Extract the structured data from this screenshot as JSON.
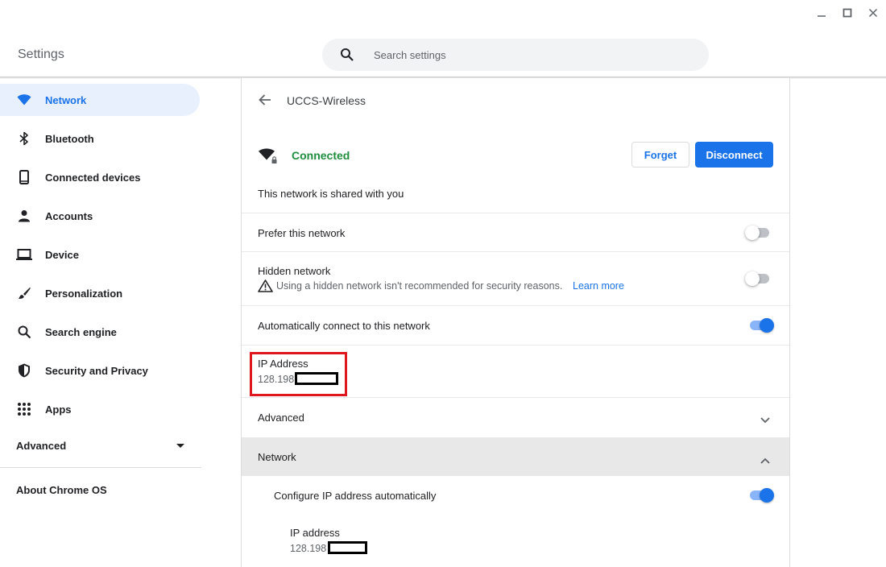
{
  "window": {
    "minimize_icon": "minimize-icon",
    "maximize_icon": "maximize-icon",
    "close_icon": "close-icon"
  },
  "header": {
    "title": "Settings",
    "search": {
      "placeholder": "Search settings",
      "value": "",
      "icon": "search-icon"
    }
  },
  "sidebar": {
    "items": [
      {
        "label": "Network",
        "icon": "wifi-icon",
        "active": true
      },
      {
        "label": "Bluetooth",
        "icon": "bluetooth-icon"
      },
      {
        "label": "Connected devices",
        "icon": "phone-icon"
      },
      {
        "label": "Accounts",
        "icon": "person-icon"
      },
      {
        "label": "Device",
        "icon": "laptop-icon"
      },
      {
        "label": "Personalization",
        "icon": "brush-icon"
      },
      {
        "label": "Search engine",
        "icon": "search-icon"
      },
      {
        "label": "Security and Privacy",
        "icon": "shield-icon"
      },
      {
        "label": "Apps",
        "icon": "apps-grid-icon"
      }
    ],
    "advanced": "Advanced",
    "about": "About Chrome OS"
  },
  "detail": {
    "title": "UCCS-Wireless",
    "status": "Connected",
    "forget_label": "Forget",
    "disconnect_label": "Disconnect",
    "shared_text": "This network is shared with you",
    "prefer": {
      "label": "Prefer this network",
      "on": false
    },
    "hidden": {
      "label": "Hidden network",
      "on": false,
      "warning": "Using a hidden network isn't recommended for security reasons.",
      "learn_more": "Learn more"
    },
    "auto_connect": {
      "label": "Automatically connect to this network",
      "on": true
    },
    "ip": {
      "label": "IP Address",
      "value": "128.198"
    },
    "advanced_label": "Advanced",
    "network_section": {
      "label": "Network",
      "configure_label": "Configure IP address automatically",
      "configure_on": true,
      "ip_label": "IP address",
      "ip_value": "128.198"
    }
  },
  "colors": {
    "accent": "#1a73e8",
    "connected_green": "#1e8e3e",
    "highlight_red": "#e0161e",
    "active_nav_bg": "#e8f0fe"
  }
}
